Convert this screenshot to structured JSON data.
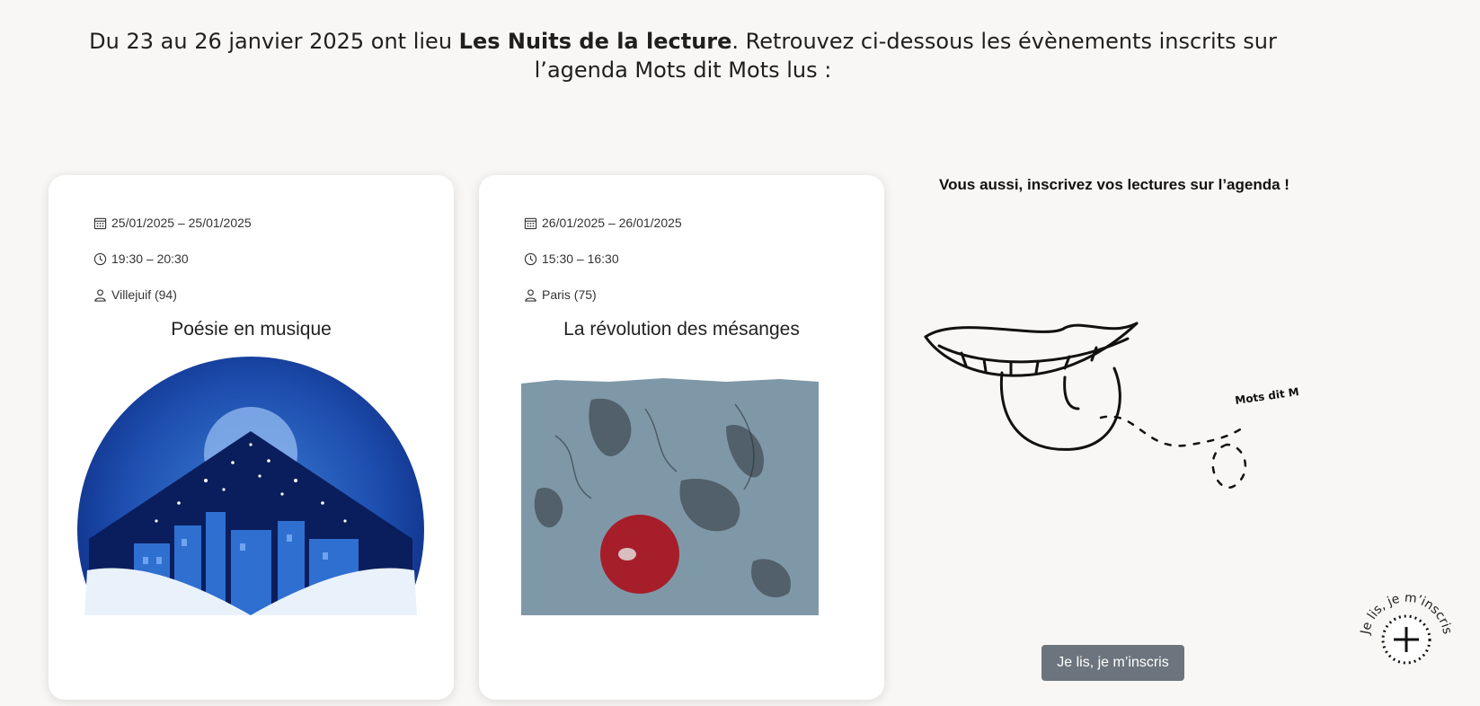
{
  "intro": {
    "prefix": "Du 23 au 26 janvier 2025 ont lieu ",
    "highlight": "Les Nuits de la lecture",
    "suffix": ". Retrouvez ci-dessous les évènements inscrits sur l’agenda Mots dit Mots lus :"
  },
  "events": [
    {
      "date": "25/01/2025 – 25/01/2025",
      "time": "19:30 – 20:30",
      "place": "Villejuif (94)",
      "title": "Poésie en musique"
    },
    {
      "date": "26/01/2025 – 26/01/2025",
      "time": "15:30 – 16:30",
      "place": "Paris (75)",
      "title": "La révolution des mésanges"
    }
  ],
  "cta": {
    "title": "Vous aussi, inscrivez vos lectures sur l’agenda !",
    "logo_text": "Mots dit Mots lus",
    "button_label": "Je lis, je m’inscris"
  },
  "floating": {
    "label": "Je lis, je m’inscris",
    "icon": "plus-icon"
  }
}
